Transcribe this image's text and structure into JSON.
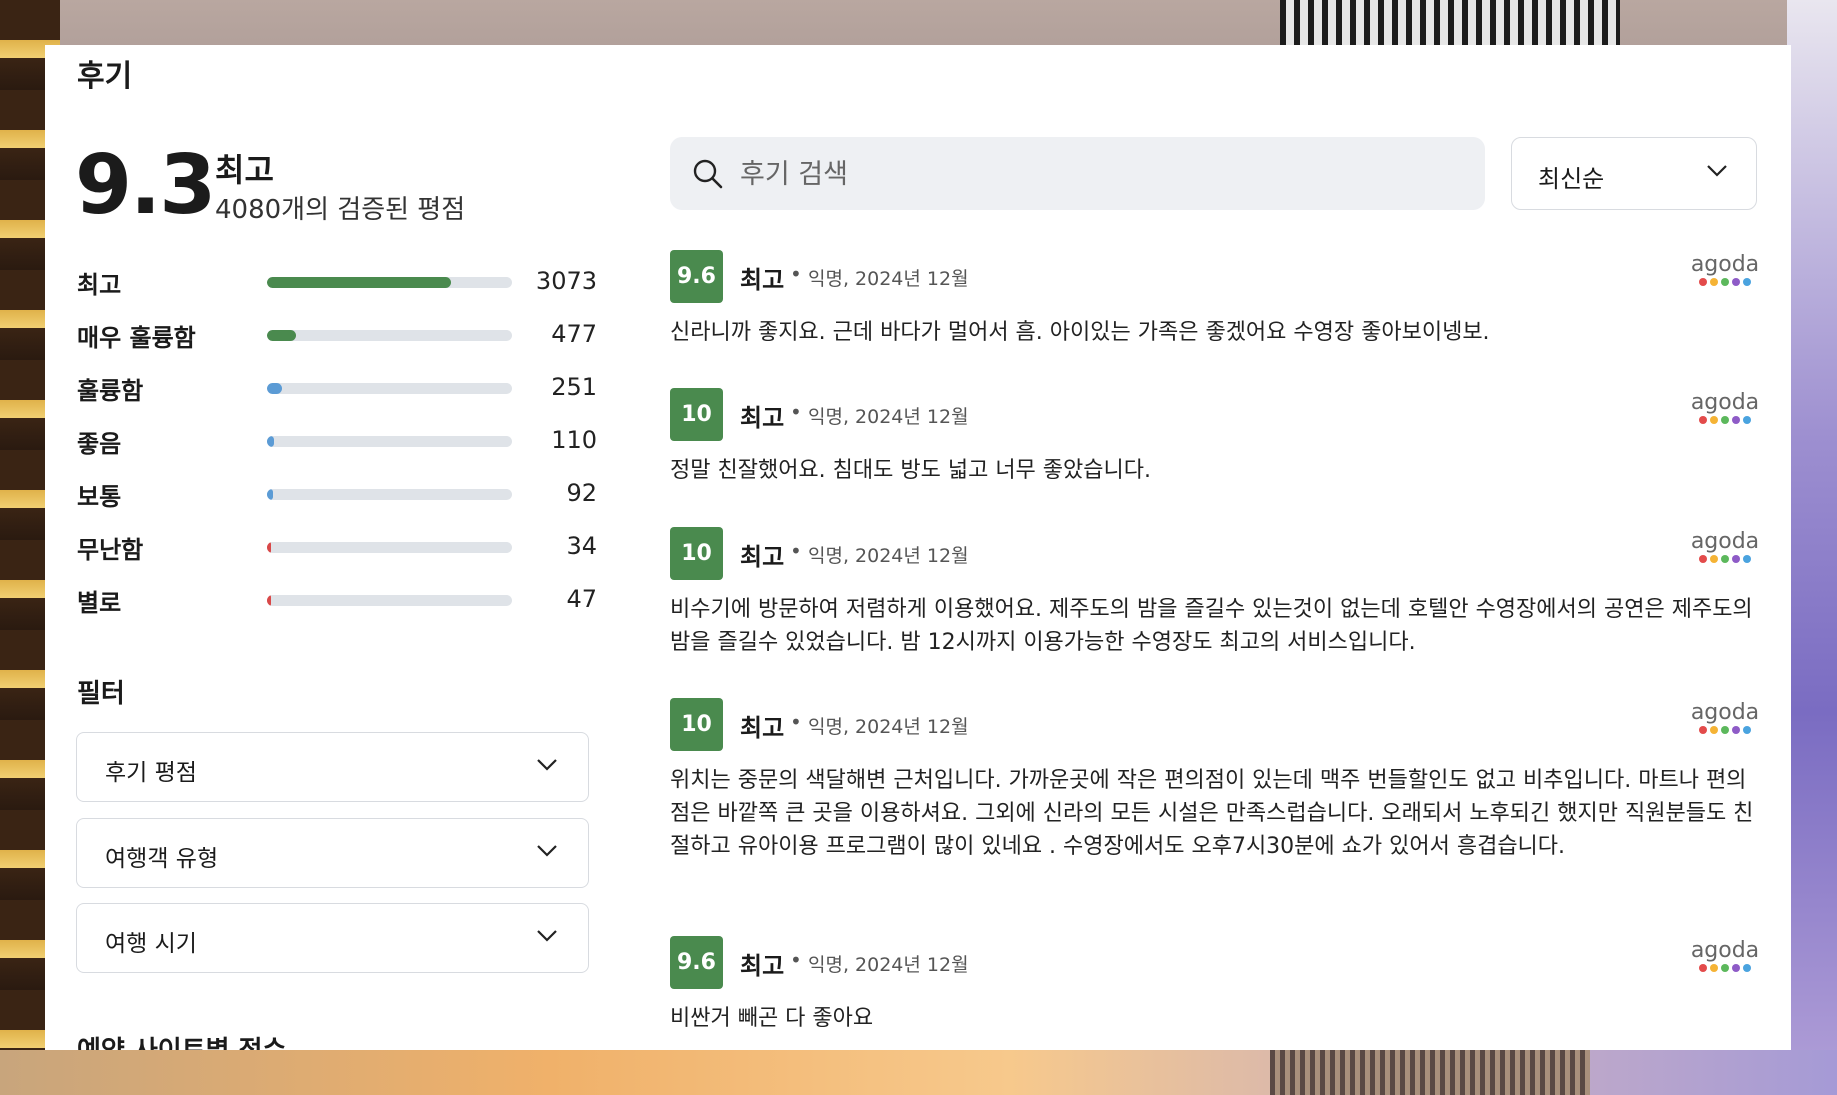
{
  "title": "후기",
  "summary": {
    "score": "9.3",
    "label": "최고",
    "count_text": "4080개의 검증된 평점"
  },
  "distribution": [
    {
      "label": "최고",
      "count": "3073",
      "fraction": 0.753,
      "color": "#4a8a4e"
    },
    {
      "label": "매우 훌륭함",
      "count": "477",
      "fraction": 0.117,
      "color": "#4a8a4e"
    },
    {
      "label": "훌륭함",
      "count": "251",
      "fraction": 0.062,
      "color": "#5b9bd5"
    },
    {
      "label": "좋음",
      "count": "110",
      "fraction": 0.027,
      "color": "#5b9bd5"
    },
    {
      "label": "보통",
      "count": "92",
      "fraction": 0.023,
      "color": "#5b9bd5"
    },
    {
      "label": "무난함",
      "count": "34",
      "fraction": 0.008,
      "color": "#d94848"
    },
    {
      "label": "별로",
      "count": "47",
      "fraction": 0.012,
      "color": "#d94848"
    }
  ],
  "filters": {
    "title": "필터",
    "items": [
      "후기 평점",
      "여행객 유형",
      "여행 시기"
    ]
  },
  "next_section": "예약 사이트별 점수",
  "search": {
    "placeholder": "후기 검색",
    "icon": "search-icon"
  },
  "sort": {
    "label": "최신순"
  },
  "source_logo": {
    "text": "agoda",
    "dot_colors": [
      "#e34b4b",
      "#f5b335",
      "#5cb85c",
      "#8e5bc7",
      "#4aa3df"
    ]
  },
  "reviews": [
    {
      "score": "9.6",
      "label": "최고",
      "meta": "익명, 2024년 12월",
      "text": "신라니까 좋지요. 근데 바다가 멀어서 흠. 아이있는 가족은 좋겠어요 수영장 좋아보이넹보."
    },
    {
      "score": "10",
      "label": "최고",
      "meta": "익명, 2024년 12월",
      "text": "정말 친잘했어요. 침대도 방도 넓고 너무 좋았습니다."
    },
    {
      "score": "10",
      "label": "최고",
      "meta": "익명, 2024년 12월",
      "text": "비수기에 방문하여 저렴하게 이용했어요. 제주도의 밤을 즐길수 있는것이 없는데 호텔안 수영장에서의 공연은 제주도의 밤을 즐길수 있었습니다. 밤 12시까지 이용가능한 수영장도 최고의 서비스입니다."
    },
    {
      "score": "10",
      "label": "최고",
      "meta": "익명, 2024년 12월",
      "text": "위치는 중문의 색달해변 근처입니다. 가까운곳에 작은 편의점이 있는데 맥주 번들할인도 없고 비추입니다. 마트나 편의점은 바깥쪽 큰 곳을 이용하셔요. 그외에 신라의 모든 시설은 만족스럽습니다. 오래되서 노후되긴 했지만 직원분들도 친절하고 유아이용 프로그램이 많이 있네요 . 수영장에서도 오후7시30분에 쇼가 있어서 흥겹습니다."
    },
    {
      "score": "9.6",
      "label": "최고",
      "meta": "익명, 2024년 12월",
      "text": "비싼거 빼곤 다 좋아요"
    }
  ]
}
